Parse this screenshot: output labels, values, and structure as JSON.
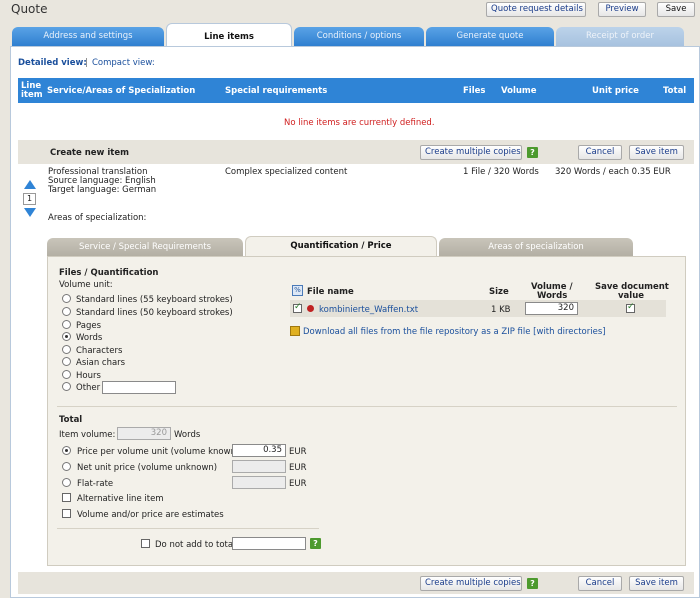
{
  "window": {
    "title": "Quote"
  },
  "top_buttons": {
    "quote_request_details": "Quote request details",
    "preview": "Preview",
    "save": "Save"
  },
  "tabs": [
    {
      "label": "Address and settings",
      "state": "normal"
    },
    {
      "label": "Line items",
      "state": "active"
    },
    {
      "label": "Conditions / options",
      "state": "normal"
    },
    {
      "label": "Generate quote",
      "state": "normal"
    },
    {
      "label": "Receipt of order",
      "state": "disabled"
    }
  ],
  "view_toggle": {
    "detailed": "Detailed view:",
    "separator": "|",
    "compact": "Compact view:"
  },
  "table_header": {
    "line_item_1": "Line",
    "line_item_2": "item",
    "service": "Service/Areas of Specialization",
    "special": "Special requirements",
    "files": "Files",
    "volume": "Volume",
    "unit_price": "Unit price",
    "total": "Total"
  },
  "empty_message": "No line items are currently defined.",
  "create_bar": {
    "title": "Create new item",
    "create_multiple": "Create multiple copies",
    "help": "?",
    "cancel": "Cancel",
    "save_item": "Save item"
  },
  "item": {
    "number": "1",
    "service": "Professional translation",
    "source": "Source language: English",
    "target": "Target language: German",
    "special": "Complex specialized content",
    "files": "1 File / 320 Words",
    "unit_price": "320 Words / each 0.35 EUR",
    "areas": "Areas of specialization:"
  },
  "subtabs": [
    {
      "label": "Service / Special Requirements",
      "state": "normal"
    },
    {
      "label": "Quantification / Price",
      "state": "active"
    },
    {
      "label": "Areas of specialization",
      "state": "normal"
    }
  ],
  "files_section": {
    "title": "Files / Quantification",
    "volume_unit": "Volume unit:",
    "units": [
      {
        "label": "Standard lines (55 keyboard strokes)",
        "selected": false
      },
      {
        "label": "Standard lines (50 keyboard strokes)",
        "selected": false
      },
      {
        "label": "Pages",
        "selected": false
      },
      {
        "label": "Words",
        "selected": true
      },
      {
        "label": "Characters",
        "selected": false
      },
      {
        "label": "Asian chars",
        "selected": false
      },
      {
        "label": "Hours",
        "selected": false
      },
      {
        "label": "Other",
        "selected": false
      }
    ]
  },
  "file_table": {
    "file_name": "File name",
    "size": "Size",
    "volume_1": "Volume /",
    "volume_2": "Words",
    "save_doc_1": "Save document",
    "save_doc_2": "value",
    "rows": [
      {
        "name": "kombinierte_Waffen.txt",
        "size": "1 KB",
        "volume": "320",
        "checked": true,
        "save": true
      }
    ],
    "download": "Download all files from the file repository as a ZIP file [with directories]"
  },
  "total_section": {
    "title": "Total",
    "item_volume": "Item volume:",
    "item_volume_value": "320",
    "item_volume_unit": "Words",
    "price_per_unit": "Price per volume unit (volume known)",
    "price_value": "0.35",
    "currency": "EUR",
    "net_unit_price": "Net unit price (volume unknown)",
    "flat_rate": "Flat-rate",
    "alt_line": "Alternative line item",
    "estimates": "Volume and/or price are estimates",
    "do_not_add": "Do not add to total"
  },
  "colors": {
    "header_blue": "#2f84d6",
    "empty_red": "#d02020",
    "link_blue": "#1a4f9c"
  }
}
